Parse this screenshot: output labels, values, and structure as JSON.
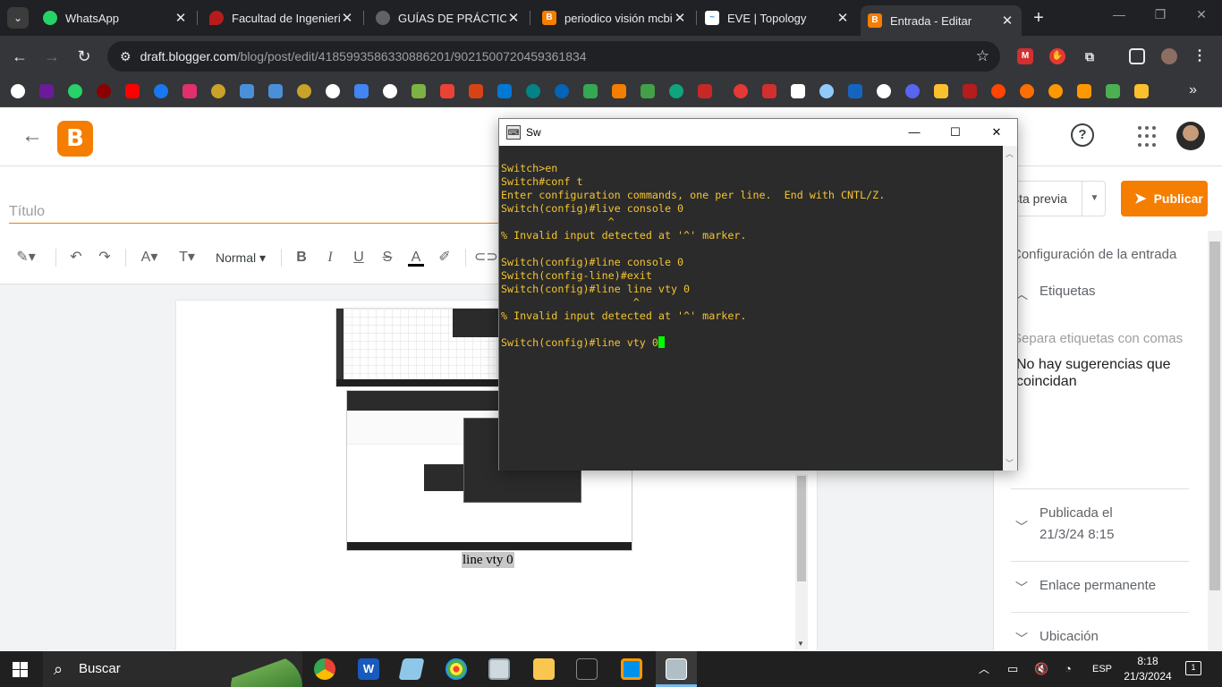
{
  "browser": {
    "tabs": [
      {
        "title": "WhatsApp",
        "favicon": "whatsapp-icon",
        "color": "#25d366"
      },
      {
        "title": "Facultad de Ingeniería",
        "favicon": "university-icon",
        "color": "#b71c1c"
      },
      {
        "title": "GUÍAS DE PRÁCTICAS",
        "favicon": "globe-icon",
        "color": "#9aa0a6"
      },
      {
        "title": "periodico visión mcbi",
        "favicon": "blogger-icon",
        "color": "#f57d00"
      },
      {
        "title": "EVE | Topology",
        "favicon": "eve-icon",
        "color": "#4a90d9"
      },
      {
        "title": "Entrada - Editar",
        "favicon": "blogger-icon",
        "color": "#f57d00",
        "active": true
      }
    ],
    "url_host": "draft.blogger.com",
    "url_path": "/blog/post/edit/4185993586330886201/9021500720459361834"
  },
  "blogger": {
    "title_placeholder": "Título",
    "format_style": "Normal",
    "caption": "line vty 0",
    "preview_label": "ista previa",
    "publish_label": "Publicar",
    "post_settings_title": "Configuración de la entrada",
    "labels_title": "Etiquetas",
    "labels_placeholder": "Separa etiquetas con comas",
    "no_suggestions": "No hay sugerencias que coincidan",
    "published_label": "Publicada el",
    "published_date": "21/3/24 8:15",
    "permalink_label": "Enlace permanente",
    "location_label": "Ubicación",
    "accent_color": "#f57d00"
  },
  "terminal": {
    "title": "Sw",
    "lines": [
      "Switch>en",
      "Switch#conf t",
      "Enter configuration commands, one per line.  End with CNTL/Z.",
      "Switch(config)#live console 0",
      "                 ^",
      "% Invalid input detected at '^' marker.",
      "",
      "Switch(config)#line console 0",
      "Switch(config-line)#exit",
      "Switch(config)#line line vty 0",
      "                     ^",
      "% Invalid input detected at '^' marker.",
      "",
      "Switch(config)#line vty 0"
    ],
    "text_color": "#f4c430",
    "cursor_color": "#00ff00"
  },
  "taskbar": {
    "search_label": "Buscar",
    "language": "ESP",
    "time": "8:18",
    "date": "21/3/2024",
    "notifications": "1"
  }
}
